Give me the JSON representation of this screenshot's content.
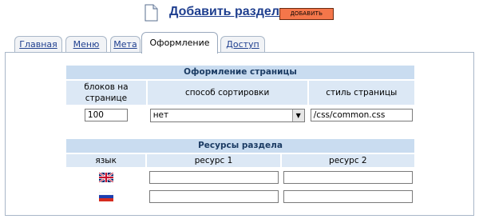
{
  "header": {
    "icon": "document-icon",
    "title": "Добавить раздел",
    "add_button": "ДОБАВИТЬ"
  },
  "tabs": [
    {
      "label": "Главная",
      "active": false
    },
    {
      "label": "Меню",
      "active": false
    },
    {
      "label": "Мета",
      "active": false
    },
    {
      "label": "Оформление",
      "active": true
    },
    {
      "label": "Доступ",
      "active": false
    }
  ],
  "page_style": {
    "title": "Оформление страницы",
    "columns": [
      "блоков на странице",
      "способ сортировки",
      "стиль страницы"
    ],
    "blocks_per_page": "100",
    "sort_method": "нет",
    "page_style_value": "/css/common.css"
  },
  "resources": {
    "title": "Ресурсы раздела",
    "columns": [
      "язык",
      "ресурс 1",
      "ресурс 2"
    ],
    "rows": [
      {
        "flag": "uk-flag-icon",
        "resource1": "",
        "resource2": ""
      },
      {
        "flag": "russia-flag-icon",
        "resource1": "",
        "resource2": ""
      }
    ]
  },
  "colors": {
    "section_header_bg": "#c9dcf0",
    "column_header_bg": "#dce8f5",
    "link": "#1f3f8f",
    "add_button_bg": "#f4764a"
  }
}
